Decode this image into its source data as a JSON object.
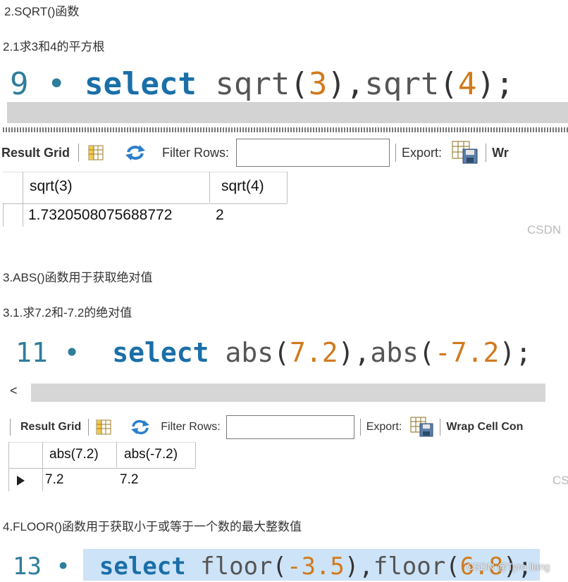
{
  "s1": {
    "heading": "2.SQRT()函数",
    "sub": "2.1求3和4的平方根",
    "line_no": "9",
    "kw": "select",
    "fn1": "sqrt",
    "arg1": "3",
    "fn2": "sqrt",
    "arg2": "4",
    "toolbar": {
      "result_grid": "Result Grid",
      "filter_rows": "Filter Rows:",
      "export": "Export:",
      "wrap": "Wr"
    },
    "columns": [
      "sqrt(3)",
      "sqrt(4)"
    ],
    "row": [
      "1.7320508075688772",
      "2"
    ],
    "watermark": "CSDN"
  },
  "s2": {
    "heading": "3.ABS()函数用于获取绝对值",
    "sub": "3.1.求7.2和-7.2的绝对值",
    "line_no": "11",
    "kw": "select",
    "fn1": "abs",
    "arg1": "7.2",
    "fn2": "abs",
    "arg2": "-7.2",
    "toolbar": {
      "result_grid": "Result Grid",
      "filter_rows": "Filter Rows:",
      "export": "Export:",
      "wrap": "Wrap Cell Con"
    },
    "columns": [
      "abs(7.2)",
      "abs(-7.2)"
    ],
    "row": [
      "7.2",
      "7.2"
    ],
    "watermark": "CS"
  },
  "s3": {
    "heading": "4.FLOOR()函数用于获取小于或等于一个数的最大整数值",
    "line_no": "13",
    "kw": "select",
    "fn1": "floor",
    "arg1": "-3.5",
    "fn2": "floor",
    "arg2": "6.8",
    "watermark": "CSDN @Tyro liang"
  },
  "colors": {
    "keyword": "#1a6fa8",
    "number": "#d17a1c",
    "selection": "#cde3f7"
  },
  "icons": [
    "grid-layout-icon",
    "refresh-icon",
    "export-table-icon",
    "row-pointer-icon",
    "scroll-left-icon"
  ]
}
